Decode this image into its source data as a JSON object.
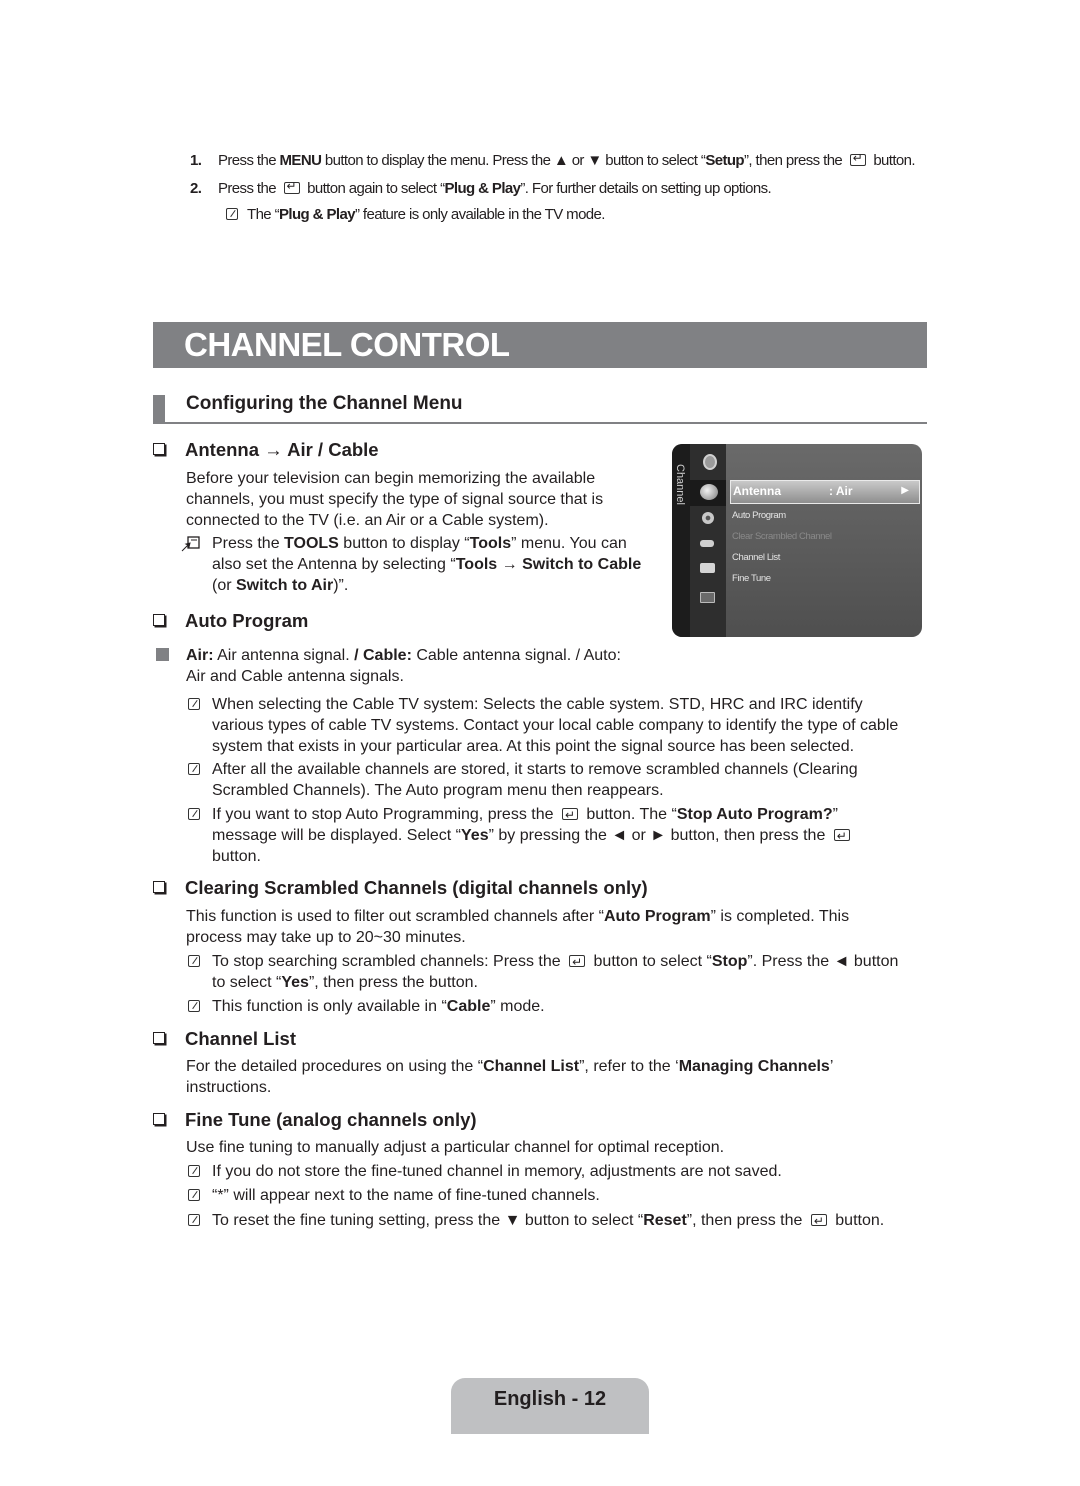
{
  "intro_steps": [
    {
      "number": "1.",
      "parts": [
        "Press the ",
        "MENU",
        " button to display the menu. Press the ▲ or ▼ button to select “",
        "Setup",
        "”, then press the ",
        "[enter]",
        " button."
      ]
    },
    {
      "number": "2.",
      "parts": [
        "Press the ",
        "[enter]",
        " button again to select “",
        "Plug & Play",
        "”. For further details on setting up options."
      ]
    }
  ],
  "intro_note": {
    "pre": "The “",
    "bold": "Plug & Play",
    "post": "” feature is only available in the TV mode."
  },
  "page_title": "CHANNEL CONTROL",
  "subsection_title": "Configuring the Channel Menu",
  "sections": {
    "antenna": {
      "heading": "Antenna → Air / Cable",
      "body": [
        "Before your television can begin memorizing the available",
        "channels, you must specify the type of signal source that is",
        "connected to the TV (i.e. an Air or a Cable system)."
      ],
      "tools_note": {
        "l1_pre": "Press the ",
        "l1_b1": "TOOLS",
        "l1_mid": " button to display “",
        "l1_b2": "Tools",
        "l1_post": "” menu. You can",
        "l2_pre": "also set the Antenna by selecting “",
        "l2_b": "Tools → Switch to Cable",
        "l3_pre": "(or ",
        "l3_b": "Switch to Air",
        "l3_post": ")”."
      }
    },
    "auto_program": {
      "heading": "Auto Program",
      "bullet": {
        "b1": "Air:",
        "t1": " Air antenna signal. ",
        "b2": "/ Cable:",
        "t2": " Cable antenna signal. / Auto:",
        "line2": "Air and Cable antenna signals."
      },
      "notes": [
        {
          "lines": [
            "When selecting the Cable TV system: Selects the cable system. STD, HRC and IRC identify",
            "various types of cable TV systems. Contact your local cable company to identify the type of cable",
            "system that exists in your particular area. At this point the signal source has been selected."
          ]
        },
        {
          "lines": [
            "After all the available channels are stored, it starts to remove scrambled channels (Clearing",
            "Scrambled Channels). The Auto program menu then reappears."
          ]
        },
        {
          "l1_pre": "If you want to stop Auto Programming, press the ",
          "l1_mid": " button. The “",
          "l1_b": "Stop Auto Program?",
          "l1_post": "”",
          "l2_pre": "message will be displayed. Select “",
          "l2_b": "Yes",
          "l2_post": "” by pressing the ◄ or ► button, then press the ",
          "l3": "button."
        }
      ]
    },
    "clearing": {
      "heading": "Clearing Scrambled Channels (digital channels only)",
      "body_pre": "This function is used to filter out scrambled channels after “",
      "body_b": "Auto Program",
      "body_post": "” is completed. This",
      "body_l2": "process may take up to 20~30 minutes.",
      "notes": [
        {
          "l1_pre": "To stop searching scrambled channels: Press the ",
          "l1_mid": " button to select “",
          "l1_b": "Stop",
          "l1_post": "”. Press the ◄ button",
          "l2_pre": "to select “",
          "l2_b": "Yes",
          "l2_post": "”, then press the  button."
        },
        {
          "pre": "This function is only available in “",
          "b": "Cable",
          "post": "” mode."
        }
      ]
    },
    "channel_list": {
      "heading": "Channel List",
      "pre": "For the detailed procedures on using the “",
      "b1": "Channel List",
      "mid": "”, refer to the ‘",
      "b2": "Managing Channels",
      "post": "’",
      "l2": "instructions."
    },
    "fine_tune": {
      "heading": "Fine Tune (analog channels only)",
      "body": "Use fine tuning to manually adjust a particular channel for optimal reception.",
      "notes": [
        "If you do not store the fine-tuned channel in memory, adjustments are not saved.",
        "“*” will appear next to the name of fine-tuned channels."
      ],
      "reset_note": {
        "pre": "To reset the fine tuning setting, press the ▼ button to select “",
        "b": "Reset",
        "mid": "”, then press the ",
        "post": " button."
      }
    }
  },
  "tv_menu": {
    "side_label": "Channel",
    "selected_item": {
      "label": "Antenna",
      "value": ": Air",
      "arrow": "▶"
    },
    "items": [
      {
        "label": "Auto Program",
        "enabled": true
      },
      {
        "label": "Clear Scrambled Channel",
        "enabled": false
      },
      {
        "label": "Channel List",
        "enabled": true
      },
      {
        "label": "Fine Tune",
        "enabled": true
      }
    ],
    "icons": [
      "input-icon",
      "channel-icon",
      "setup-icon",
      "sound-icon",
      "picture-icon",
      "support-icon"
    ]
  },
  "footer": {
    "page_label": "English - 12"
  }
}
